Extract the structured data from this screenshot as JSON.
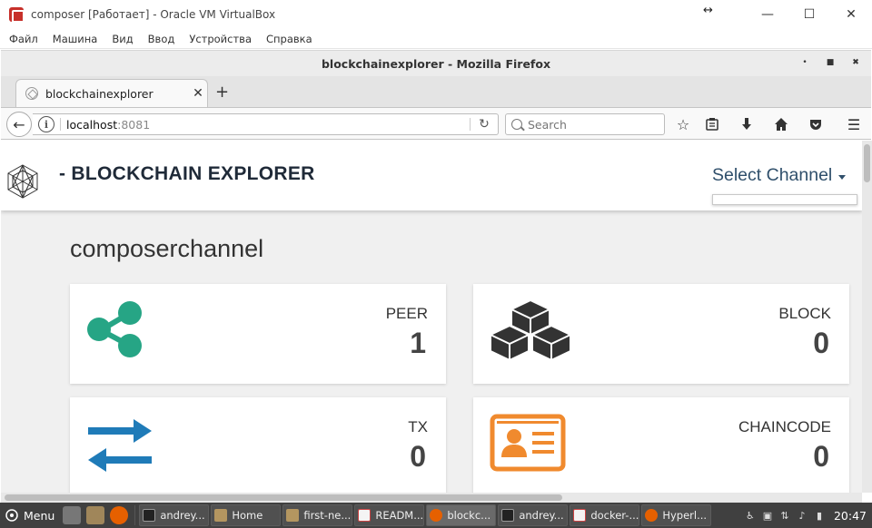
{
  "vbox": {
    "title": "composer [Работает] - Oracle VM VirtualBox",
    "menu": [
      "Файл",
      "Машина",
      "Вид",
      "Ввод",
      "Устройства",
      "Справка"
    ]
  },
  "firefox": {
    "window_title": "blockchainexplorer - Mozilla Firefox",
    "tab_label": "blockchainexplorer",
    "url_host": "localhost",
    "url_port": ":8081",
    "search_placeholder": "Search"
  },
  "app": {
    "brand": "- BLOCKCHAIN EXPLORER",
    "select_channel": "Select Channel",
    "channel_name": "composerchannel",
    "cards": [
      {
        "label": "PEER",
        "value": "1",
        "icon": "share-icon",
        "color": "#26a585"
      },
      {
        "label": "BLOCK",
        "value": "0",
        "icon": "cubes-icon",
        "color": "#333333"
      },
      {
        "label": "TX",
        "value": "0",
        "icon": "exchange-arrows-icon",
        "color": "#1f7bb8"
      },
      {
        "label": "CHAINCODE",
        "value": "0",
        "icon": "id-card-icon",
        "color": "#f08a2e"
      }
    ]
  },
  "taskbar": {
    "menu_label": "Menu",
    "tasks": [
      "andrey...",
      "Home",
      "first-ne...",
      "READM...",
      "blockc...",
      "andrey...",
      "docker-...",
      "Hyperl..."
    ],
    "clock": "20:47"
  }
}
